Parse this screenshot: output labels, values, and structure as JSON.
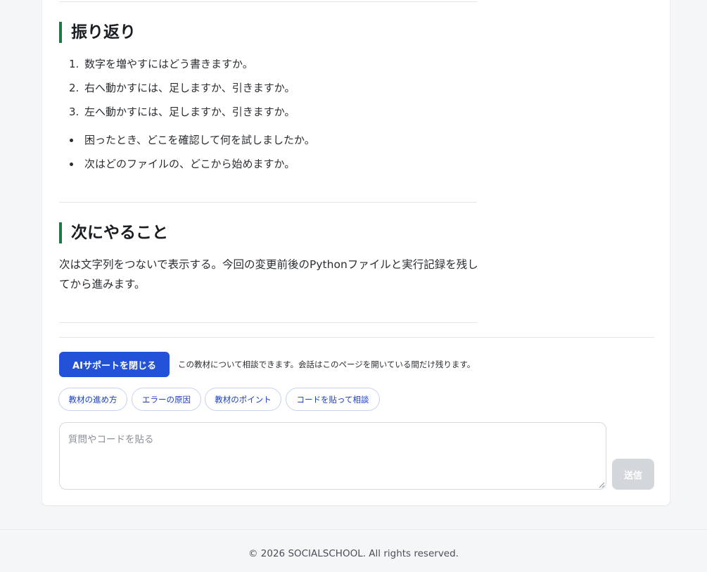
{
  "review": {
    "title": "振り返り",
    "ordered": [
      {
        "num": "1.",
        "text": "数字を増やすにはどう書きますか。"
      },
      {
        "num": "2.",
        "text": "右へ動かすには、足しますか、引きますか。"
      },
      {
        "num": "3.",
        "text": "左へ動かすには、足しますか、引きますか。"
      }
    ],
    "bullets": [
      "困ったとき、どこを確認して何を試しましたか。",
      "次はどのファイルの、どこから始めますか。"
    ]
  },
  "next": {
    "title": "次にやること",
    "text": "次は文字列をつないで表示する。今回の変更前後のPythonファイルと実行記録を残してから進みます。"
  },
  "ai_support": {
    "close_button": "AIサポートを閉じる",
    "note": "この教材について相談できます。会話はこのページを開いている間だけ残ります。",
    "chips": [
      "教材の進め方",
      "エラーの原因",
      "教材のポイント",
      "コードを貼って相談"
    ],
    "input_placeholder": "質問やコードを貼る",
    "input_value": "",
    "send_button": "送信"
  },
  "colors": {
    "accent_bar": "#1e7a45",
    "primary_button": "#2352d9",
    "chip_text": "#1b3fbf",
    "send_disabled": "#d3d6db"
  },
  "footer": {
    "copyright": "© 2026 SOCIALSCHOOL. All rights reserved."
  }
}
